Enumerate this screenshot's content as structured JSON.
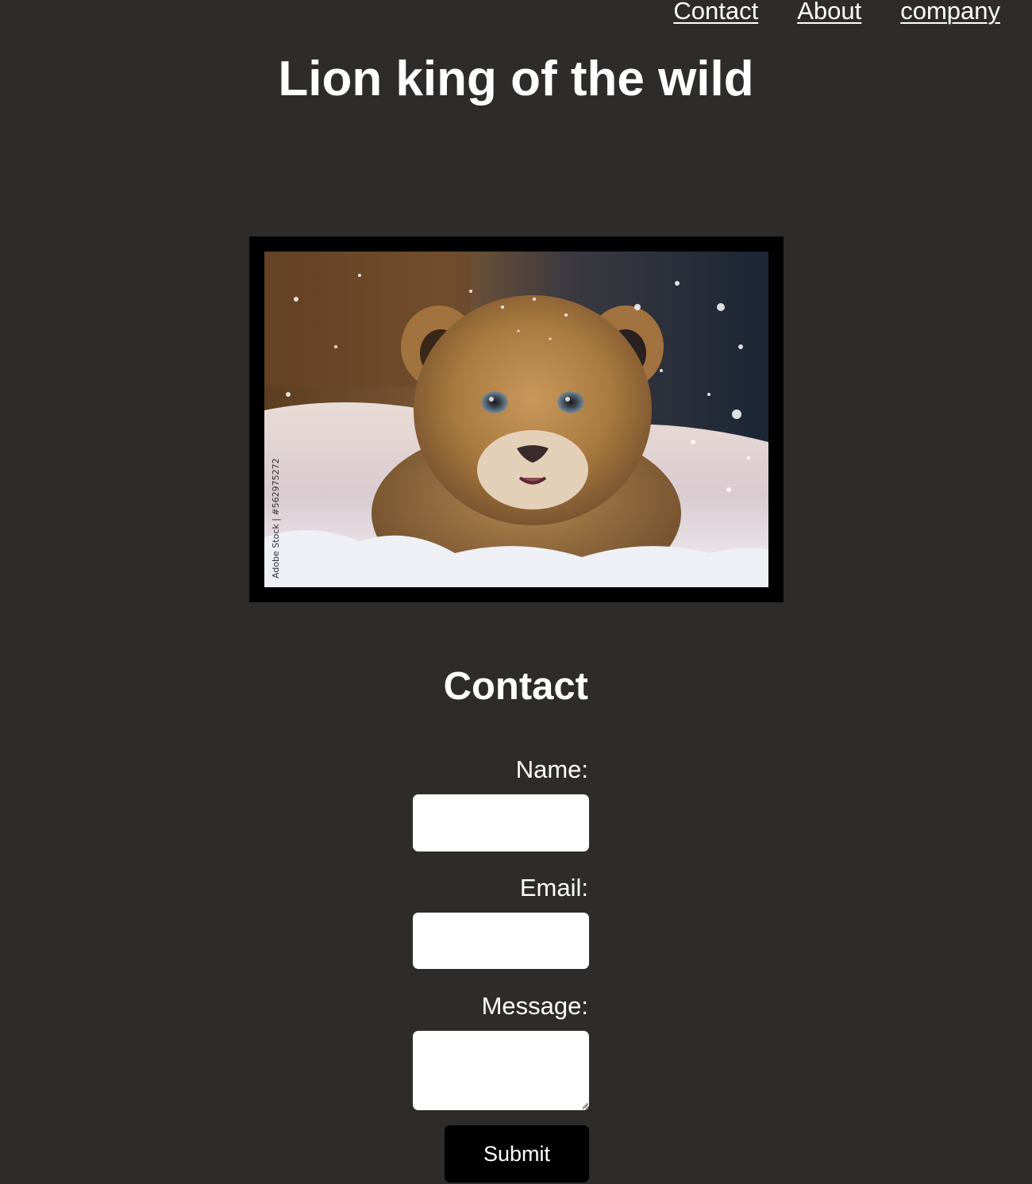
{
  "nav": {
    "links": [
      {
        "label": "Contact"
      },
      {
        "label": "About"
      },
      {
        "label": "company"
      }
    ]
  },
  "header": {
    "title": "Lion king of the wild"
  },
  "hero": {
    "image_subject": "lion cub in snow",
    "watermark_text": "Adobe Stock | #562975272",
    "frame_color": "#000000"
  },
  "contact": {
    "heading": "Contact",
    "fields": [
      {
        "label": "Name:",
        "value": ""
      },
      {
        "label": "Email:",
        "value": ""
      },
      {
        "label": "Message:",
        "value": ""
      }
    ],
    "submit_label": "Submit"
  },
  "colors": {
    "background": "#2d2c2b",
    "text": "#ffffff",
    "button": "#000000",
    "input": "#ffffff"
  }
}
